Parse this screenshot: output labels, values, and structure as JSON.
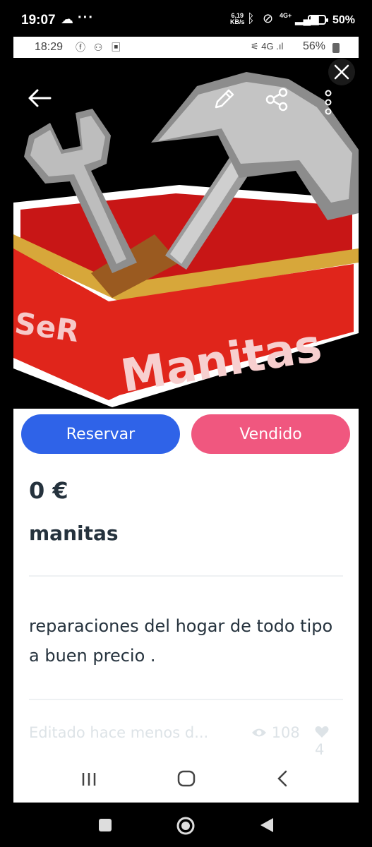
{
  "outer_status": {
    "time": "19:07",
    "speed_top": "6,19",
    "speed_bottom": "KB/s",
    "network": "4G+",
    "battery_pct": "50%"
  },
  "inner_status": {
    "time": "18:29",
    "network": "4G",
    "battery_pct": "56%"
  },
  "hero": {
    "box_text_left": "SeR",
    "box_text_main": "Manitas"
  },
  "actions": {
    "reserve_label": "Reservar",
    "sold_label": "Vendido"
  },
  "listing": {
    "price": "0 €",
    "title": "manitas",
    "description": "reparaciones del hogar de todo tipo a buen precio .",
    "edited": "Editado hace menos d...",
    "views": "108",
    "likes": "4"
  },
  "colors": {
    "reserve": "#2f63e8",
    "sold": "#f0577f",
    "text": "#25323d"
  }
}
